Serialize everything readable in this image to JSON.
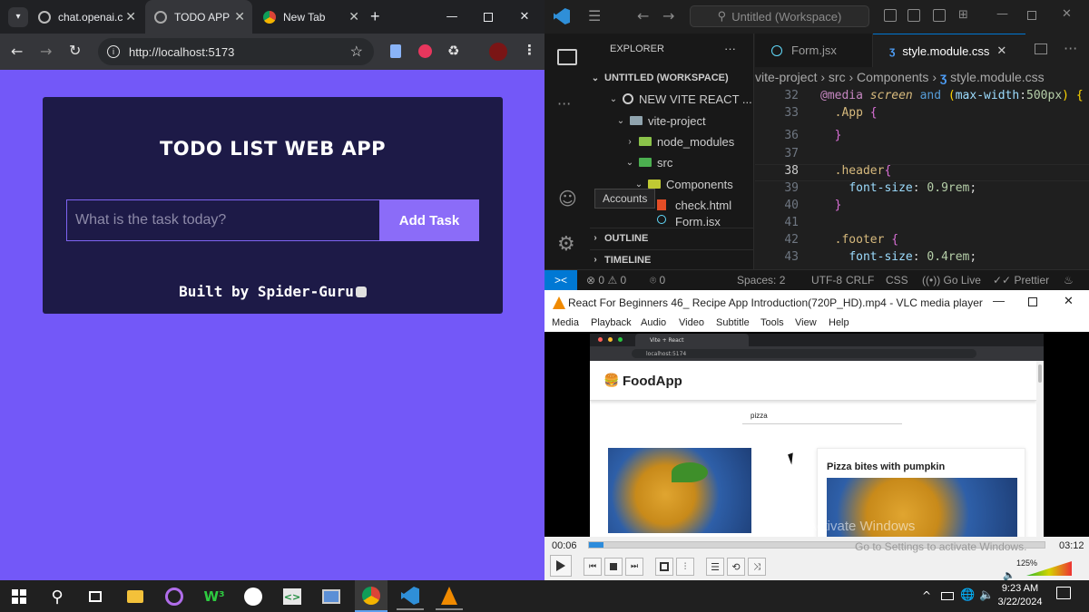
{
  "chrome": {
    "tabs": [
      {
        "label": "chat.openai.c"
      },
      {
        "label": "TODO APP"
      },
      {
        "label": "New Tab"
      }
    ],
    "url": "http://localhost:5173"
  },
  "todo_app": {
    "title": "TODO LIST WEB APP",
    "input_placeholder": "What is the task today?",
    "add_button": "Add Task",
    "footer": "Built by Spider-Guru"
  },
  "vscode": {
    "search": "Untitled (Workspace)",
    "explorer_title": "EXPLORER",
    "workspace": "UNTITLED (WORKSPACE)",
    "tree": [
      "NEW VITE REACT ...",
      "vite-project",
      "node_modules",
      "src",
      "Components",
      "check.html",
      "Form.jsx"
    ],
    "outline": "OUTLINE",
    "timeline": "TIMELINE",
    "accounts_tooltip": "Accounts",
    "tabs": [
      "Form.jsx",
      "style.module.css"
    ],
    "breadcrumb": [
      "vite-project",
      "src",
      "Components",
      "style.module.css"
    ],
    "lines": [
      {
        "n": "32",
        "t": "@media screen and (max-width:500px) {"
      },
      {
        "n": "33",
        "t": "  .App {"
      },
      {
        "n": "36",
        "t": "  }"
      },
      {
        "n": "37",
        "t": ""
      },
      {
        "n": "38",
        "t": "  .header{"
      },
      {
        "n": "39",
        "t": "    font-size: 0.9rem;"
      },
      {
        "n": "40",
        "t": "  }"
      },
      {
        "n": "41",
        "t": ""
      },
      {
        "n": "42",
        "t": "  .footer {"
      },
      {
        "n": "43",
        "t": "    font-size: 0.4rem;"
      }
    ],
    "status": {
      "errors": "0",
      "warnings": "0",
      "ports": "0",
      "spaces": "Spaces: 2",
      "encoding": "UTF-8",
      "eol": "CRLF",
      "lang": "CSS",
      "golive": "Go Live",
      "prettier": "Prettier"
    }
  },
  "vlc": {
    "title": "React For Beginners 46_ Recipe App Introduction(720P_HD).mp4 - VLC media player",
    "menu": [
      "Media",
      "Playback",
      "Audio",
      "Video",
      "Subtitle",
      "Tools",
      "View",
      "Help"
    ],
    "time_elapsed": "00:06",
    "time_total": "03:12",
    "progress": 0.031,
    "volume": "125%",
    "video": {
      "tab_title": "Vite + React",
      "url": "localhost:5174",
      "app_name": "FoodApp",
      "search_value": "pizza",
      "card_title": "Pizza bites with pumpkin",
      "watermark_1": "Activate Windows",
      "watermark_2": "Go to Settings to activate Windows."
    }
  },
  "taskbar": {
    "time": "9:23 AM",
    "date": "3/22/2024"
  }
}
